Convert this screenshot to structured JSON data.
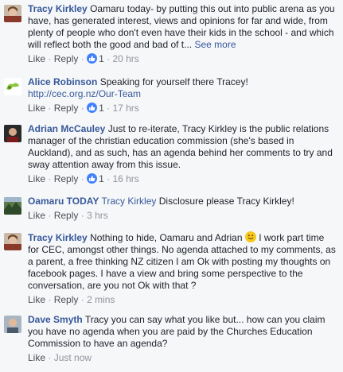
{
  "comments": [
    {
      "author": "Tracy Kirkley",
      "text": "Oamaru today- by putting this out into public arena as you have, has generated interest, views and opinions for far and wide, from plenty of people who don't even have their kids in the school - and which will reflect both the good and bad of t...",
      "see_more": "See more",
      "like": "Like",
      "reply": "Reply",
      "likes": "1",
      "time": "20 hrs",
      "avatar": "tracy-avatar"
    },
    {
      "author": "Alice Robinson",
      "text": "Speaking for yourself there Tracey!",
      "link": "http://cec.org.nz/Our-Team",
      "like": "Like",
      "reply": "Reply",
      "likes": "1",
      "time": "17 hrs",
      "avatar": "alice-avatar"
    },
    {
      "author": "Adrian McCauley",
      "text": "Just to re-iterate, Tracy Kirkley is the public relations manager of the christian education commission (she's based in Auckland), and as such, has an agenda behind her comments to try and sway attention away from this issue.",
      "like": "Like",
      "reply": "Reply",
      "likes": "1",
      "time": "16 hrs",
      "avatar": "adrian-avatar"
    },
    {
      "author": "Oamaru TODAY",
      "mention": "Tracy Kirkley",
      "text": "Disclosure please Tracy Kirkley!",
      "like": "Like",
      "reply": "Reply",
      "time": "3 hrs",
      "avatar": "oamaru-avatar"
    },
    {
      "author": "Tracy Kirkley",
      "text_before": "Nothing to hide, Oamaru and Adrian",
      "text_after": "I work part time for CEC, amongst other things. No agenda attached to my comments, as a parent, a free thinking NZ citizen I am Ok with posting my thoughts on facebook pages. I have a view and bring some perspective to the conversation, are you not Ok with that ?",
      "like": "Like",
      "reply": "Reply",
      "time": "2 mins",
      "avatar": "tracy-avatar",
      "emoji": "smiley-icon"
    },
    {
      "author": "Dave Smyth",
      "text": "Tracy you can say what you like but... how can you claim you have no agenda when you are paid by the Churches Education Commission to have an agenda?",
      "like": "Like",
      "time": "Just now",
      "avatar": "dave-avatar"
    }
  ],
  "colors": {
    "link": "#365899",
    "meta": "#90949c",
    "like_badge": "#4080ff",
    "background": "#f6f7f9"
  }
}
